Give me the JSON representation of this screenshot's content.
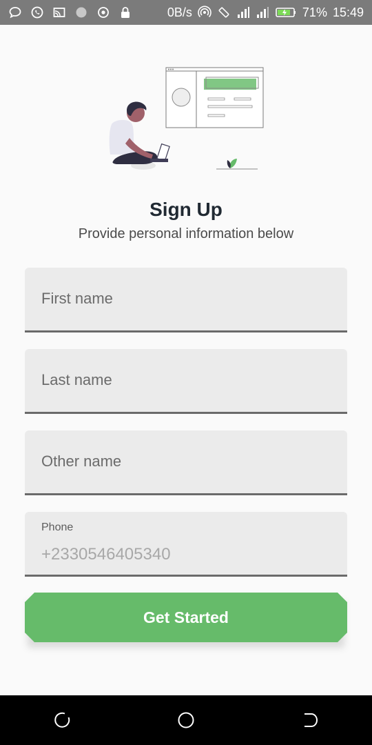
{
  "status_bar": {
    "speed": "0B/s",
    "battery": "71%",
    "time": "15:49",
    "icons": [
      "chat-bubble-icon",
      "whatsapp-icon",
      "cast-icon",
      "circle-icon",
      "target-icon",
      "lock-icon",
      "hotspot-icon",
      "rotate-icon",
      "signal-icon",
      "signal-icon",
      "battery-charging-icon"
    ]
  },
  "header": {
    "title": "Sign Up",
    "subtitle": "Provide personal information below"
  },
  "form": {
    "first_name_placeholder": "First name",
    "last_name_placeholder": "Last name",
    "other_name_placeholder": "Other name",
    "phone_label": "Phone",
    "phone_value": "+2330546405340"
  },
  "cta": {
    "label": "Get Started"
  },
  "colors": {
    "accent": "#66bb6a",
    "status_bar": "#7b7b7b",
    "field_bg": "#ebebeb"
  },
  "nav_bar": {
    "icons": [
      "recent-apps-icon",
      "home-icon",
      "back-icon"
    ]
  }
}
